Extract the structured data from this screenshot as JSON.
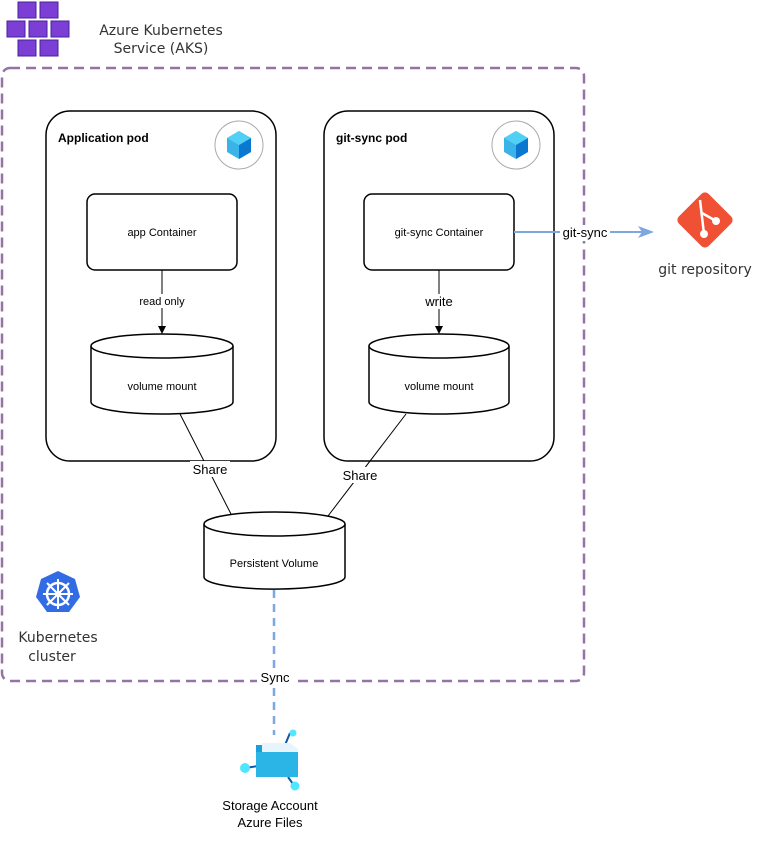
{
  "aks": {
    "line1": "Azure Kubernetes",
    "line2": "Service (AKS)",
    "icon": "aks-icon"
  },
  "cluster": {
    "line1": "Kubernetes",
    "line2": "cluster",
    "icon": "kubernetes-icon"
  },
  "app_pod": {
    "title": "Application pod",
    "container": "app Container",
    "edge": "read only",
    "volume": "volume mount"
  },
  "git_pod": {
    "title": "git-sync pod",
    "container": "git-sync Container",
    "edge": "write",
    "volume": "volume mount"
  },
  "pv": {
    "label": "Persistent Volume",
    "share_left": "Share",
    "share_right": "Share"
  },
  "git": {
    "edge": "git-sync",
    "label": "git repository",
    "icon": "git-icon"
  },
  "storage": {
    "edge": "Sync",
    "line1": "Storage Account",
    "line2": "Azure Files",
    "icon": "azure-files-icon"
  },
  "colors": {
    "cluster_border": "#9673a6",
    "sync_line": "#7ea6e0",
    "git": "#f05033",
    "k8s": "#326ce5",
    "aks": "#773adc"
  }
}
